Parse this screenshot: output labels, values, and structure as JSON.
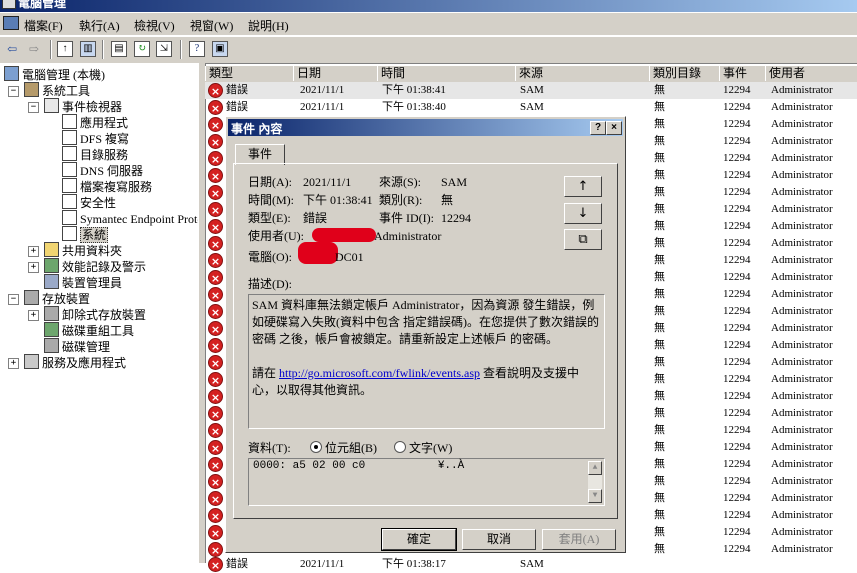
{
  "window": {
    "title": "電腦管理"
  },
  "menu": [
    "檔案(F)",
    "執行(A)",
    "檢視(V)",
    "視窗(W)",
    "說明(H)"
  ],
  "tree": [
    {
      "label": "電腦管理 (本機)",
      "icon": "computer-icon"
    },
    {
      "label": "系統工具",
      "icon": "tools-icon"
    },
    {
      "label": "事件檢視器",
      "icon": "event-viewer-icon"
    },
    {
      "label": "應用程式",
      "icon": "log-icon"
    },
    {
      "label": "DFS 複寫",
      "icon": "log-icon"
    },
    {
      "label": "目錄服務",
      "icon": "log-icon"
    },
    {
      "label": "DNS 伺服器",
      "icon": "log-icon"
    },
    {
      "label": "檔案複寫服務",
      "icon": "log-icon"
    },
    {
      "label": "安全性",
      "icon": "log-icon"
    },
    {
      "label": "Symantec Endpoint Prote",
      "icon": "log-icon"
    },
    {
      "label": "系統",
      "icon": "log-icon"
    },
    {
      "label": "共用資料夾",
      "icon": "folder-icon"
    },
    {
      "label": "效能記錄及警示",
      "icon": "perf-icon"
    },
    {
      "label": "裝置管理員",
      "icon": "device-icon"
    },
    {
      "label": "存放裝置",
      "icon": "storage-icon"
    },
    {
      "label": "卸除式存放裝置",
      "icon": "removable-icon"
    },
    {
      "label": "磁碟重組工具",
      "icon": "defrag-icon"
    },
    {
      "label": "磁碟管理",
      "icon": "disk-icon"
    },
    {
      "label": "服務及應用程式",
      "icon": "services-icon"
    }
  ],
  "list": {
    "columns": [
      "類型",
      "日期",
      "時間",
      "來源",
      "類別目錄",
      "事件",
      "使用者"
    ],
    "top_rows": [
      {
        "type": "錯誤",
        "date": "2021/11/1",
        "time": "下午 01:38:41",
        "source": "SAM",
        "category": "無",
        "event": "12294",
        "user": "Administrator"
      },
      {
        "type": "錯誤",
        "date": "2021/11/1",
        "time": "下午 01:38:40",
        "source": "SAM",
        "category": "無",
        "event": "12294",
        "user": "Administrator"
      }
    ],
    "category": "無",
    "event": "12294",
    "user": "Administrator",
    "partial_row": {
      "type": "錯誤",
      "date": "2021/11/1",
      "time": "下午 01:38:17",
      "source": "SAM"
    }
  },
  "dialog": {
    "title": "事件 內容",
    "help_btn": "?",
    "close_btn": "×",
    "tab": "事件",
    "date_label": "日期(A):",
    "date_value": "2021/11/1",
    "source_label": "來源(S):",
    "source_value": "SAM",
    "time_label": "時間(M):",
    "time_value": "下午 01:38:41",
    "category_label": "類別(R):",
    "category_value": "無",
    "type_label": "類型(E):",
    "type_value": "錯誤",
    "eventid_label": "事件 ID(I):",
    "eventid_value": "12294",
    "user_label": "使用者(U):",
    "user_value": "Administrator",
    "computer_label": "電腦(O):",
    "computer_value": "DC01",
    "desc_label": "描述(D):",
    "desc_p1": "SAM 資料庫無法鎖定帳戶 Administrator，因為資源 發生錯誤，例如硬碟寫入失敗(資料中包含 指定錯誤碼)。在您提供了數次錯誤的密碼 之後，帳戶會被鎖定。請重新設定上述帳戶 的密碼。",
    "desc_p2_pre": "請在 ",
    "desc_link": "http://go.microsoft.com/fwlink/events.asp",
    "desc_p2_post": " 查看說明及支援中心，以取得其他資訊。",
    "data_label": "資料(T):",
    "radio_bytes": "位元組(B)",
    "radio_words": "文字(W)",
    "data_line": "0000: a5 02 00 c0           ¥..À",
    "btn_up": "↑",
    "btn_down": "↓",
    "btn_copy": "⧉",
    "ok": "確定",
    "cancel": "取消",
    "apply": "套用(A)"
  }
}
